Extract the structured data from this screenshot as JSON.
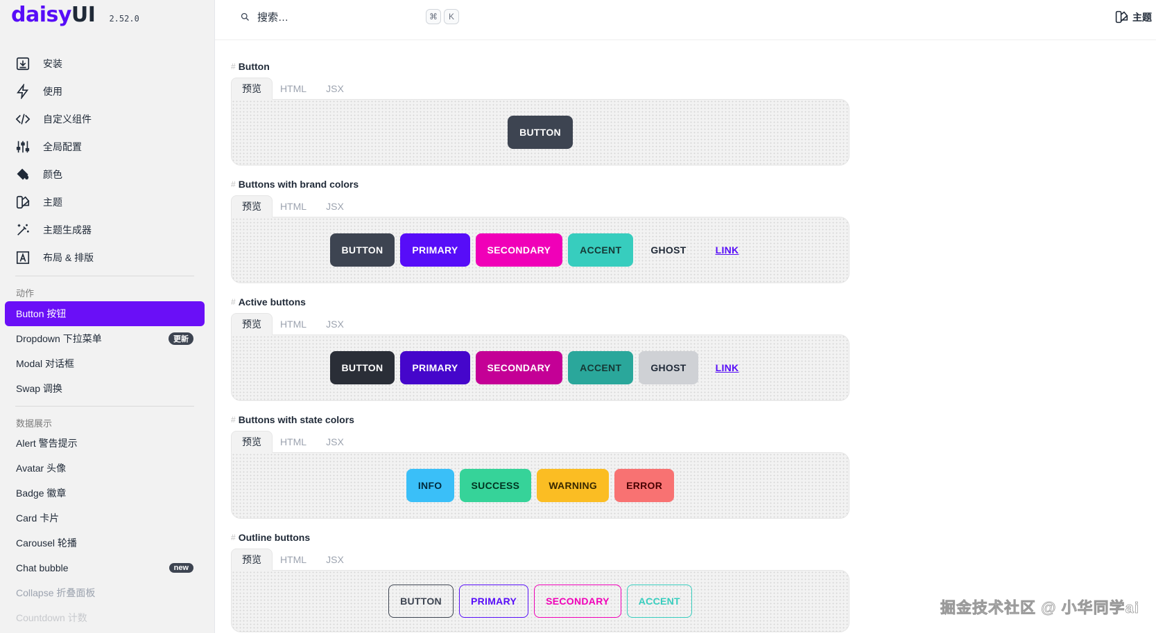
{
  "brand": {
    "logo_main": "daisy",
    "logo_ui": "UI",
    "version": "2.52.0"
  },
  "topbar": {
    "search_placeholder": "搜索…",
    "kbd_cmd": "⌘",
    "kbd_k": "K",
    "theme_label": "主题"
  },
  "sidebar": {
    "main_items": [
      {
        "label": "安装",
        "icon": "install-icon"
      },
      {
        "label": "使用",
        "icon": "bolt-icon"
      },
      {
        "label": "自定义组件",
        "icon": "code-icon"
      },
      {
        "label": "全局配置",
        "icon": "sliders-icon"
      },
      {
        "label": "颜色",
        "icon": "paint-bucket-icon"
      },
      {
        "label": "主题",
        "icon": "swatch-icon"
      },
      {
        "label": "主题生成器",
        "icon": "magic-wand-icon"
      },
      {
        "label": "布局 & 排版",
        "icon": "typography-icon"
      }
    ],
    "section_actions": "动作",
    "actions": [
      {
        "label": "Button 按钮",
        "badge": ""
      },
      {
        "label": "Dropdown 下拉菜单",
        "badge": "更新"
      },
      {
        "label": "Modal 对话框",
        "badge": ""
      },
      {
        "label": "Swap 调换",
        "badge": ""
      }
    ],
    "section_data": "数据展示",
    "data_items": [
      {
        "label": "Alert 警告提示",
        "badge": ""
      },
      {
        "label": "Avatar 头像",
        "badge": ""
      },
      {
        "label": "Badge 徽章",
        "badge": ""
      },
      {
        "label": "Card 卡片",
        "badge": ""
      },
      {
        "label": "Carousel 轮播",
        "badge": ""
      },
      {
        "label": "Chat bubble",
        "badge": "new"
      },
      {
        "label": "Collapse 折叠面板",
        "badge": ""
      },
      {
        "label": "Countdown 计数",
        "badge": ""
      }
    ]
  },
  "tabs": {
    "preview": "预览",
    "html": "HTML",
    "jsx": "JSX"
  },
  "sections": [
    {
      "title": "Button",
      "buttons": [
        "BUTTON"
      ]
    },
    {
      "title": "Buttons with brand colors",
      "buttons": [
        "BUTTON",
        "PRIMARY",
        "SECONDARY",
        "ACCENT",
        "GHOST",
        "LINK"
      ]
    },
    {
      "title": "Active buttons",
      "buttons": [
        "BUTTON",
        "PRIMARY",
        "SECONDARY",
        "ACCENT",
        "GHOST",
        "LINK"
      ]
    },
    {
      "title": "Buttons with state colors",
      "buttons": [
        "INFO",
        "SUCCESS",
        "WARNING",
        "ERROR"
      ]
    },
    {
      "title": "Outline buttons",
      "buttons": [
        "BUTTON",
        "PRIMARY",
        "SECONDARY",
        "ACCENT"
      ]
    }
  ],
  "colors": {
    "primary": "#570df8",
    "secondary": "#f000b8",
    "accent": "#37cdbe",
    "neutral": "#3d4451",
    "info": "#3abff8",
    "success": "#36d399",
    "warning": "#fbbd23",
    "error": "#f87272",
    "sidebar_active": "#6a0ff7"
  },
  "watermark": "掘金技术社区 @ 小华同学ai"
}
